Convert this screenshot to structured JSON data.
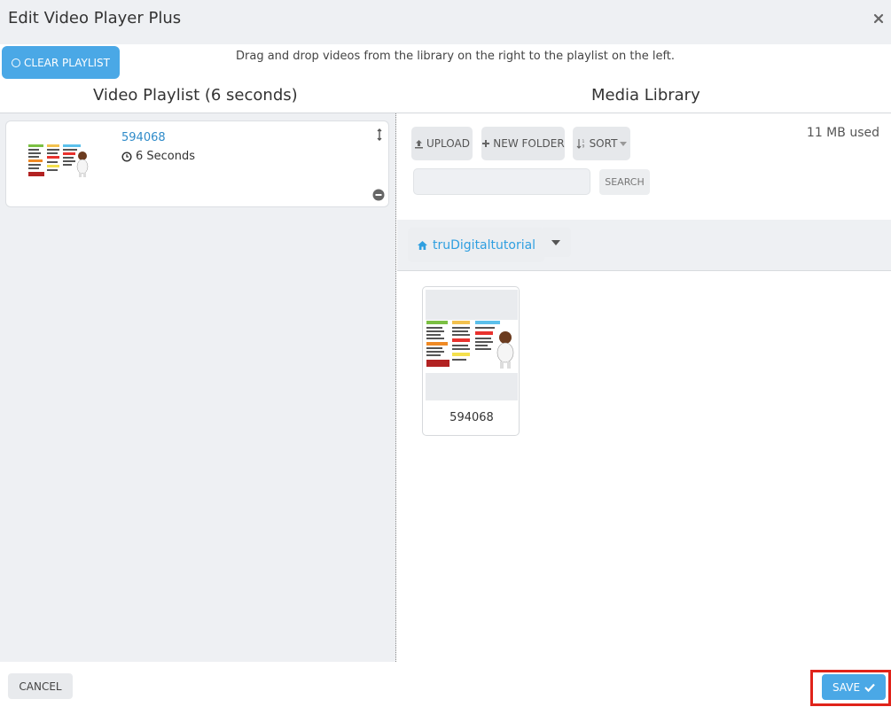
{
  "modal": {
    "title": "Edit Video Player Plus"
  },
  "toolbar": {
    "clear_playlist_label": "CLEAR PLAYLIST",
    "instructions": "Drag and drop videos from the library on the right to the playlist on the left."
  },
  "playlist": {
    "title": "Video Playlist (6 seconds)",
    "items": [
      {
        "name": "594068",
        "duration": "6 Seconds"
      }
    ]
  },
  "library": {
    "title": "Media Library",
    "upload_label": "UPLOAD",
    "new_folder_label": "NEW FOLDER",
    "sort_label": "SORT",
    "storage_used": "11 MB used",
    "search_placeholder": "",
    "search_button_label": "SEARCH",
    "current_folder": "truDigitaltutorial",
    "items": [
      {
        "name": "594068"
      }
    ]
  },
  "footer": {
    "cancel_label": "CANCEL",
    "save_label": "SAVE"
  },
  "colors": {
    "accent": "#4aa8e6",
    "link": "#2f8bc9",
    "highlight": "#e0231a",
    "panel_bg": "#eef0f3"
  }
}
